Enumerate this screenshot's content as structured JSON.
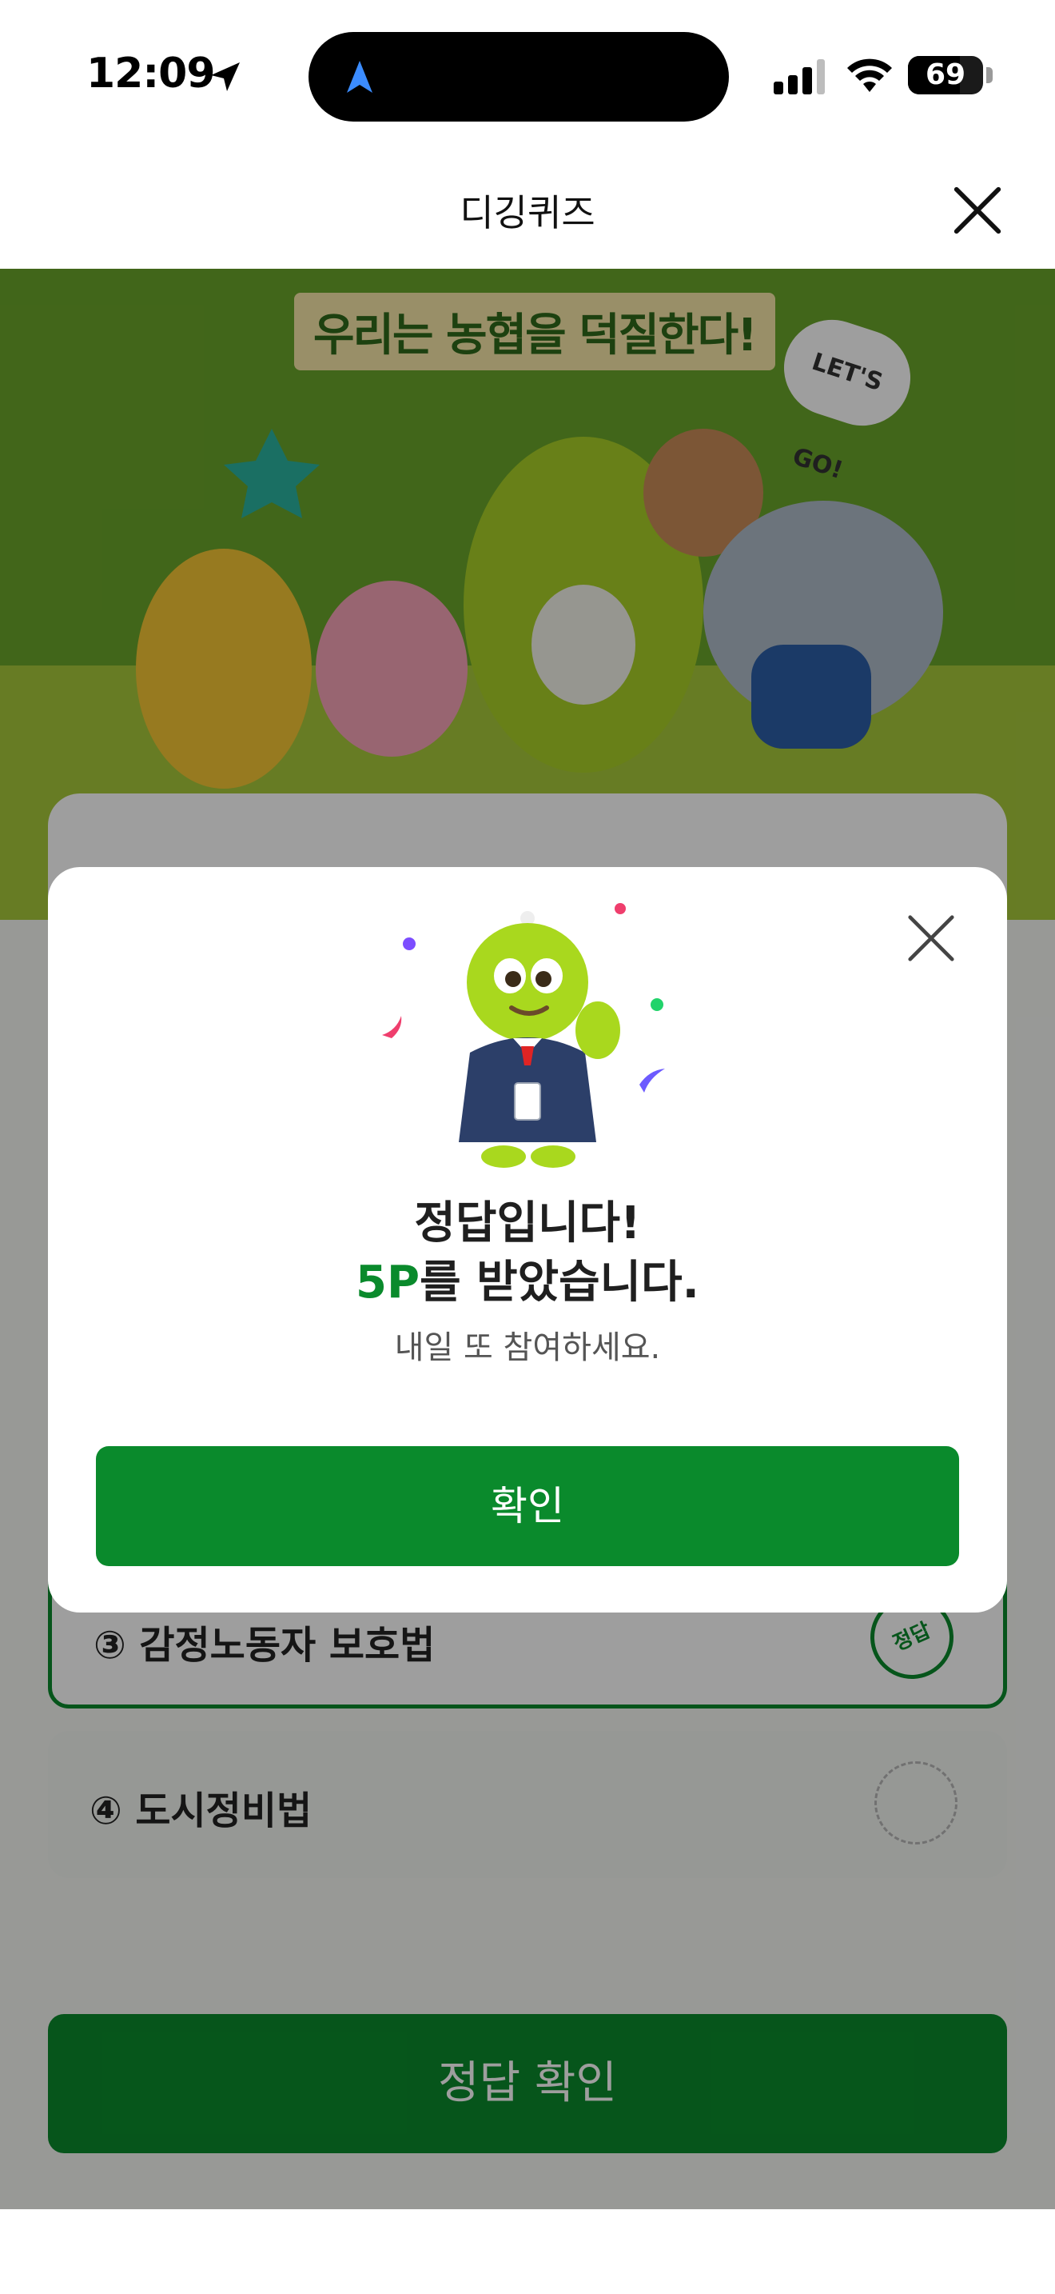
{
  "status_bar": {
    "time": "12:09",
    "battery": "69",
    "battery_level": 0.69
  },
  "header": {
    "title": "디깅퀴즈"
  },
  "banner": {
    "slogan": "우리는 농협을 덕질한다!",
    "bubble": "LET'S GO!"
  },
  "quiz": {
    "options": [
      {
        "label": "③ 감정노동자 보호법",
        "badge": "정답"
      },
      {
        "label": "④ 도시정비법"
      }
    ],
    "submit_label": "정답 확인"
  },
  "modal": {
    "title_line1": "정답입니다!",
    "points": "5P",
    "title_line2_rest": "를 받았습니다.",
    "subtitle": "내일 또 참여하세요.",
    "confirm_label": "확인"
  },
  "colors": {
    "accent": "#0a8a2c",
    "banner_green": "#6aa52a",
    "ground_green": "#a7c83b"
  },
  "icons": [
    "location-arrow-icon",
    "navigation-icon",
    "signal-icon",
    "wifi-icon",
    "battery-icon",
    "close-icon",
    "confetti-icon"
  ]
}
